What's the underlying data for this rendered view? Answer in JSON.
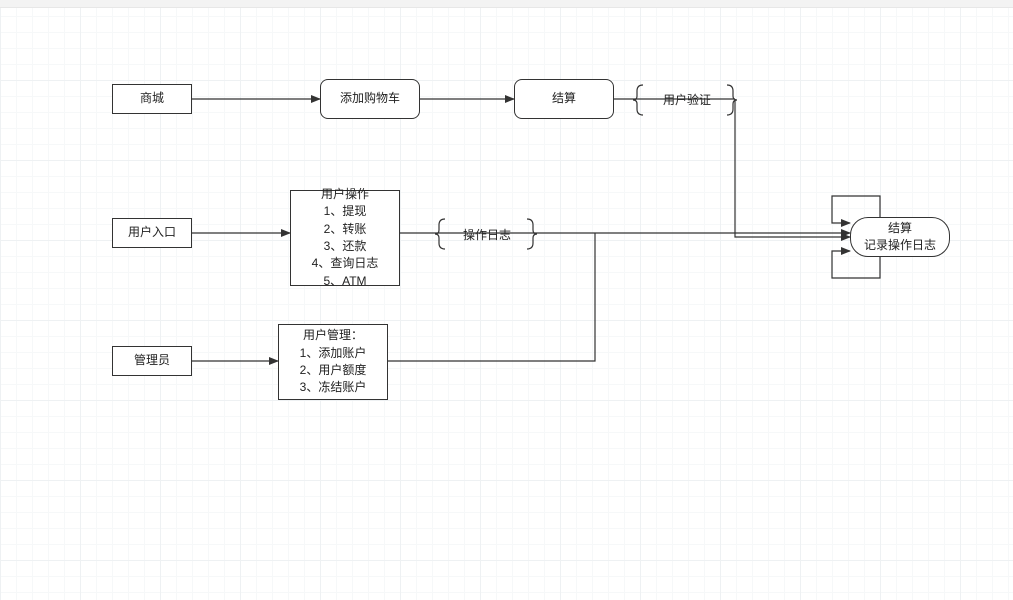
{
  "nodes": {
    "mall": "商城",
    "add_to_cart": "添加购物车",
    "checkout": "结算",
    "user_entry": "用户入口",
    "user_ops": "用户操作\n1、提现\n2、转账\n3、还款\n4、查询日志\n5、ATM",
    "admin": "管理员",
    "user_mgmt": "用户管理：\n1、添加账户\n2、用户额度\n3、冻结账户",
    "terminator": "结算\n记录操作日志"
  },
  "labels": {
    "user_verify": "用户验证",
    "op_log": "操作日志"
  }
}
